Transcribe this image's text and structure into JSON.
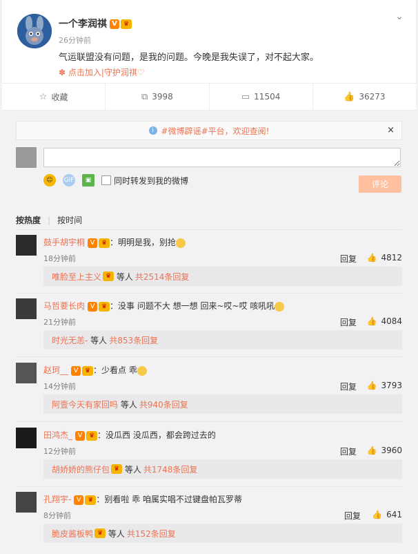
{
  "post": {
    "author": "一个李润祺",
    "verified_badge": "V",
    "vip_badge": "♛",
    "time": "26分钟前",
    "text": "气运联盟没有问题，是我的问题。今晚是我失误了，对不起大家。",
    "link": "点击加入|守护润祺♡",
    "more_icon": "chevron-down-icon"
  },
  "actions": [
    {
      "icon": "star-icon",
      "label": "收藏"
    },
    {
      "icon": "share-icon",
      "label": "3998"
    },
    {
      "icon": "comment-icon",
      "label": "11504"
    },
    {
      "icon": "thumb-up-icon",
      "label": "36273"
    }
  ],
  "notice": {
    "text": "#微博辟谣#平台，欢迎查阅!",
    "close": "×"
  },
  "composer": {
    "placeholder": "",
    "forward_label": "同时转发到我的微博",
    "submit_label": "评论"
  },
  "sort": {
    "hot": "按热度",
    "time": "按时间"
  },
  "comments": [
    {
      "name": "鼓手胡宇桐",
      "text": "明明是我，别抢",
      "time": "18分钟前",
      "reply_label": "回复",
      "likes": "4812",
      "reply_from": "唯脸至上主义",
      "reply_etc": "等人",
      "reply_total": "共2514条回复"
    },
    {
      "name": "马哲要长肉",
      "text": "没事 问题不大 想一想 回来~哎~哎 咳吼吼",
      "time": "21分钟前",
      "reply_label": "回复",
      "likes": "4084",
      "reply_from": "时光无恙-",
      "reply_etc": "等人",
      "reply_total": "共853条回复"
    },
    {
      "name": "赵珂__",
      "text": "少看点 乖",
      "time": "14分钟前",
      "reply_label": "回复",
      "likes": "3793",
      "reply_from": "阿壹今天有家回吗",
      "reply_etc": "等人",
      "reply_total": "共940条回复"
    },
    {
      "name": "田鸿杰_",
      "text": "没瓜西 没瓜西，都会跨过去的",
      "time": "12分钟前",
      "reply_label": "回复",
      "likes": "3960",
      "reply_from": "胡娇娇的熊仔包",
      "reply_etc": "等人",
      "reply_total": "共1748条回复"
    },
    {
      "name": "孔翔宇-",
      "text": "别看啦 乖 咱属实唱不过键盘帕瓦罗蒂",
      "time": "8分钟前",
      "reply_label": "回复",
      "likes": "641",
      "reply_from": "脆皮酱板鸭",
      "reply_etc": "等人",
      "reply_total": "共152条回复"
    }
  ],
  "colors": {
    "accent": "#eb7350",
    "submit_bg": "#ffc09f",
    "badge_orange": "#ff8200"
  }
}
